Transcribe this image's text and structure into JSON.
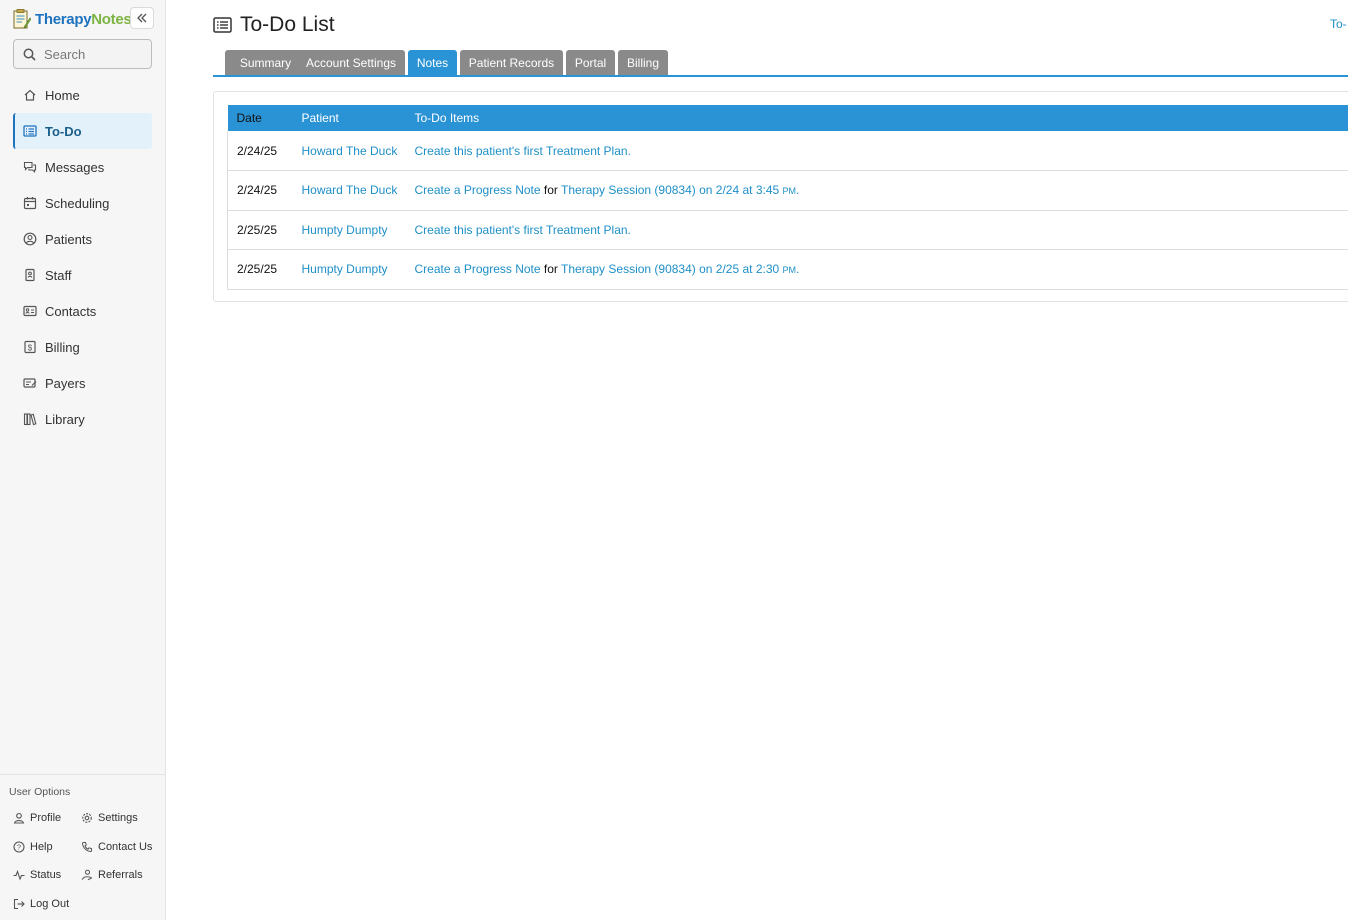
{
  "brand": {
    "part1": "Therapy",
    "part2": "Notes",
    "reg": "®"
  },
  "search": {
    "placeholder": "Search"
  },
  "nav": [
    {
      "label": "Home",
      "icon": "home-icon"
    },
    {
      "label": "To-Do",
      "icon": "todo-list-icon",
      "active": true
    },
    {
      "label": "Messages",
      "icon": "messages-icon"
    },
    {
      "label": "Scheduling",
      "icon": "calendar-icon"
    },
    {
      "label": "Patients",
      "icon": "patient-icon"
    },
    {
      "label": "Staff",
      "icon": "staff-badge-icon"
    },
    {
      "label": "Contacts",
      "icon": "contact-card-icon"
    },
    {
      "label": "Billing",
      "icon": "dollar-icon"
    },
    {
      "label": "Payers",
      "icon": "payers-card-icon"
    },
    {
      "label": "Library",
      "icon": "library-books-icon"
    }
  ],
  "user_options": {
    "title": "User Options",
    "items": [
      {
        "label": "Profile",
        "icon": "user-icon"
      },
      {
        "label": "Settings",
        "icon": "gear-icon"
      },
      {
        "label": "Help",
        "icon": "help-circle-icon"
      },
      {
        "label": "Contact Us",
        "icon": "phone-icon"
      },
      {
        "label": "Status",
        "icon": "pulse-icon"
      },
      {
        "label": "Referrals",
        "icon": "referral-icon"
      },
      {
        "label": "Log Out",
        "icon": "logout-icon"
      }
    ]
  },
  "page": {
    "title": "To-Do List",
    "top_link": "To-"
  },
  "tabs": [
    {
      "label": "Summary"
    },
    {
      "label": "Account Settings"
    },
    {
      "label": "Notes",
      "active": true
    },
    {
      "label": "Patient Records"
    },
    {
      "label": "Portal"
    },
    {
      "label": "Billing"
    }
  ],
  "table": {
    "headers": {
      "date": "Date",
      "patient": "Patient",
      "items": "To-Do Items"
    },
    "rows": [
      {
        "date": "2/24/25",
        "patient": "Howard The Duck",
        "item_link": "Create this patient's first Treatment Plan.",
        "item_mid": "",
        "item_link2": "",
        "item_ampm": "",
        "item_end": ""
      },
      {
        "date": "2/24/25",
        "patient": "Howard The Duck",
        "item_link": "Create a Progress Note",
        "item_mid": " for ",
        "item_link2": "Therapy Session (90834) on 2/24 at 3:45 ",
        "item_ampm": "pm",
        "item_end": "."
      },
      {
        "date": "2/25/25",
        "patient": "Humpty Dumpty",
        "item_link": "Create this patient's first Treatment Plan.",
        "item_mid": "",
        "item_link2": "",
        "item_ampm": "",
        "item_end": ""
      },
      {
        "date": "2/25/25",
        "patient": "Humpty Dumpty",
        "item_link": "Create a Progress Note",
        "item_mid": " for ",
        "item_link2": "Therapy Session (90834) on 2/25 at 2:30 ",
        "item_ampm": "pm",
        "item_end": "."
      }
    ]
  },
  "colors": {
    "accent": "#2a93d5",
    "link": "#1e8fc7",
    "tab_inactive": "#8a8a8a",
    "active_nav_bg": "#e3f1fb"
  }
}
